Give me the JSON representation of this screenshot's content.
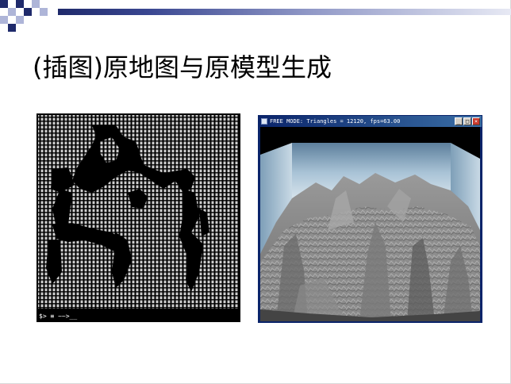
{
  "slide": {
    "title": "(插图)原地图与原模型生成"
  },
  "map_image": {
    "caption_line": "$> ≡ ~~>__"
  },
  "render_window": {
    "title": "FREE MODE: Triangles = 12120, fps=63.00",
    "buttons": [
      "_",
      "□",
      "×"
    ]
  },
  "colors": {
    "band_start": "#1f2a6b",
    "accent": "#3a4791",
    "titlebar": "#0a246a"
  }
}
